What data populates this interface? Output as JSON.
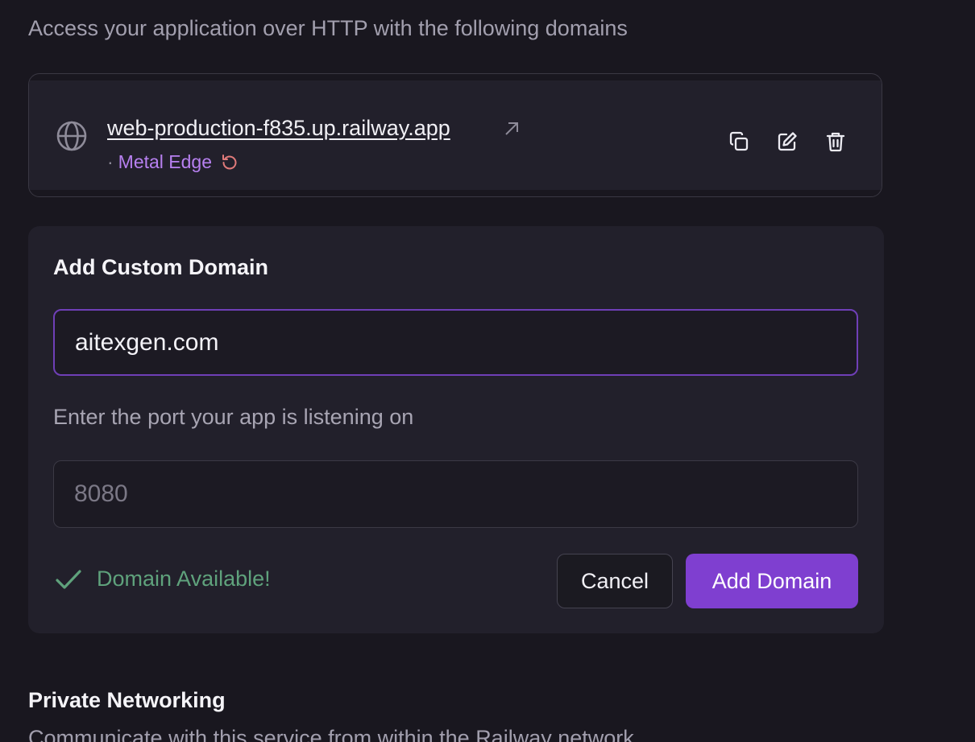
{
  "intro": "Access your application over HTTP with the following domains",
  "domain_card": {
    "domain": "web-production-f835.up.railway.app",
    "edge_separator": "·",
    "edge_label": "Metal Edge",
    "icons": [
      "globe-icon",
      "external-link-icon",
      "refresh-icon",
      "copy-icon",
      "edit-icon",
      "trash-icon"
    ]
  },
  "custom_domain": {
    "title": "Add Custom Domain",
    "domain_value": "aitexgen.com",
    "port_label": "Enter the port your app is listening on",
    "port_placeholder": "8080",
    "status_text": "Domain Available!",
    "cancel_label": "Cancel",
    "add_label": "Add Domain"
  },
  "private_networking": {
    "title": "Private Networking",
    "subtitle": "Communicate with this service from within the Railway network"
  },
  "colors": {
    "accent": "#7f3fd0",
    "edge_label": "#b780f0",
    "success": "#5fa27c",
    "refresh": "#e07a7a"
  }
}
